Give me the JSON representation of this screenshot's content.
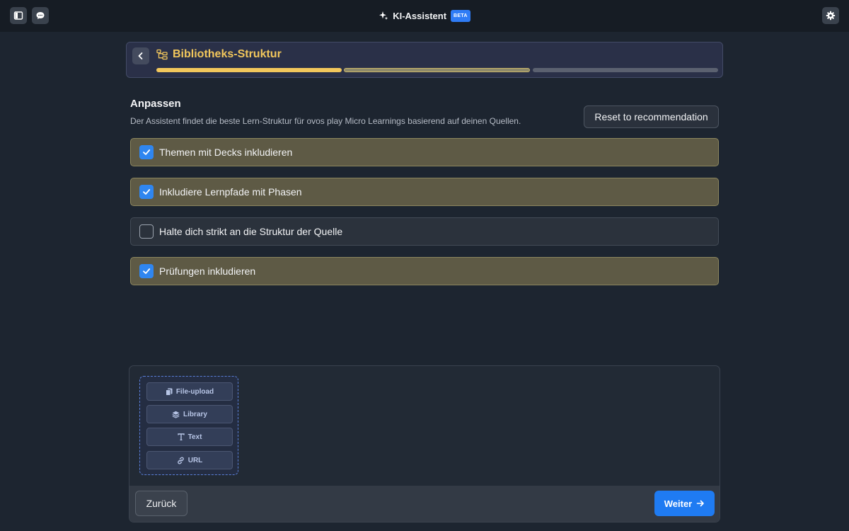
{
  "topbar": {
    "title": "KI-Assistent",
    "badge": "BETA",
    "left_icons": [
      "sidebar-icon",
      "chat-icon"
    ],
    "right_icons": [
      "gear-icon"
    ]
  },
  "header": {
    "title": "Bibliotheks-Struktur",
    "icon": "structure-icon",
    "progress_steps": [
      {
        "state": "done",
        "color": "#f2c75c"
      },
      {
        "state": "current",
        "color": "#8f8a6a"
      },
      {
        "state": "pending",
        "color": "#5b6170"
      }
    ]
  },
  "main": {
    "title": "Anpassen",
    "description": "Der Assistent findet die beste Lern-Struktur für ovos play Micro Learnings basierend auf deinen Quellen.",
    "reset_label": "Reset to recommendation",
    "options": [
      {
        "label": "Themen mit Decks inkludieren",
        "checked": true
      },
      {
        "label": "Inkludiere Lernpfade mit Phasen",
        "checked": true
      },
      {
        "label": "Halte dich strikt an die Struktur der Quelle",
        "checked": false
      },
      {
        "label": "Prüfungen inkludieren",
        "checked": true
      }
    ]
  },
  "sources": {
    "buttons": [
      {
        "label": "File-upload",
        "icon": "files-icon"
      },
      {
        "label": "Library",
        "icon": "layers-icon"
      },
      {
        "label": "Text",
        "icon": "text-icon"
      },
      {
        "label": "URL",
        "icon": "link-icon"
      }
    ]
  },
  "footer": {
    "back_label": "Zurück",
    "next_label": "Weiter"
  },
  "colors": {
    "accent": "#2f86f0",
    "title_yellow": "#f2c75c",
    "checked_bg": "#5e5a45"
  }
}
